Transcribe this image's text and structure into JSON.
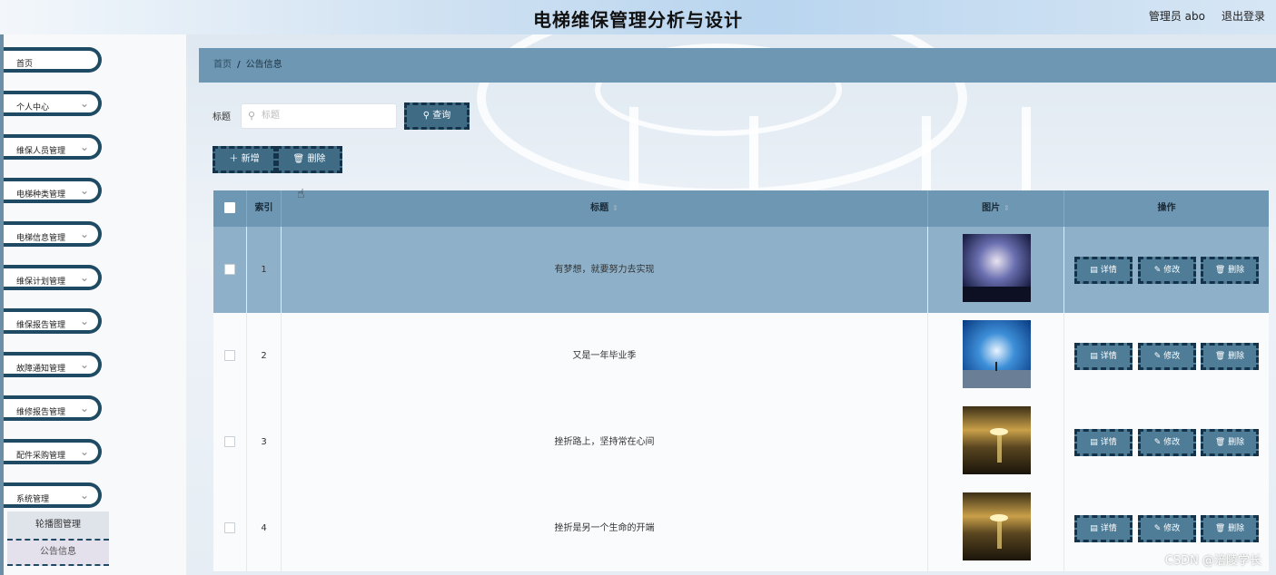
{
  "header": {
    "title": "电梯维保管理分析与设计",
    "user": "管理员 abo",
    "logout": "退出登录"
  },
  "sidebar": {
    "items": [
      {
        "label": "首页"
      },
      {
        "label": "个人中心"
      },
      {
        "label": "维保人员管理"
      },
      {
        "label": "电梯种类管理"
      },
      {
        "label": "电梯信息管理"
      },
      {
        "label": "维保计划管理"
      },
      {
        "label": "维保报告管理"
      },
      {
        "label": "故障通知管理"
      },
      {
        "label": "维修报告管理"
      },
      {
        "label": "配件采购管理"
      },
      {
        "label": "系统管理"
      }
    ],
    "submenu": [
      {
        "label": "轮播图管理"
      },
      {
        "label": "公告信息"
      }
    ]
  },
  "breadcrumb": {
    "home": "首页",
    "separator": "/",
    "current": "公告信息"
  },
  "search": {
    "label": "标题",
    "placeholder": "标题",
    "button": "查询"
  },
  "toolbar": {
    "add": "新增",
    "delete": "删除"
  },
  "table": {
    "columns": [
      "索引",
      "标题",
      "图片",
      "操作"
    ],
    "rows": [
      {
        "index": "1",
        "title": "有梦想，就要努力去实现",
        "image": "night-sky-crowd"
      },
      {
        "index": "2",
        "title": "又是一年毕业季",
        "image": "blue-sky-beach"
      },
      {
        "index": "3",
        "title": "挫折路上，坚持常在心间",
        "image": "sunset-sea"
      },
      {
        "index": "4",
        "title": "挫折是另一个生命的开端",
        "image": "sunset-sea"
      }
    ],
    "actions": {
      "detail": "详情",
      "edit": "修改",
      "delete": "删除"
    }
  },
  "watermark": "CSDN @涪陵学长",
  "colors": {
    "accent": "#6d97b3",
    "dark": "#14324a",
    "highlight": "#8eb0c8"
  }
}
